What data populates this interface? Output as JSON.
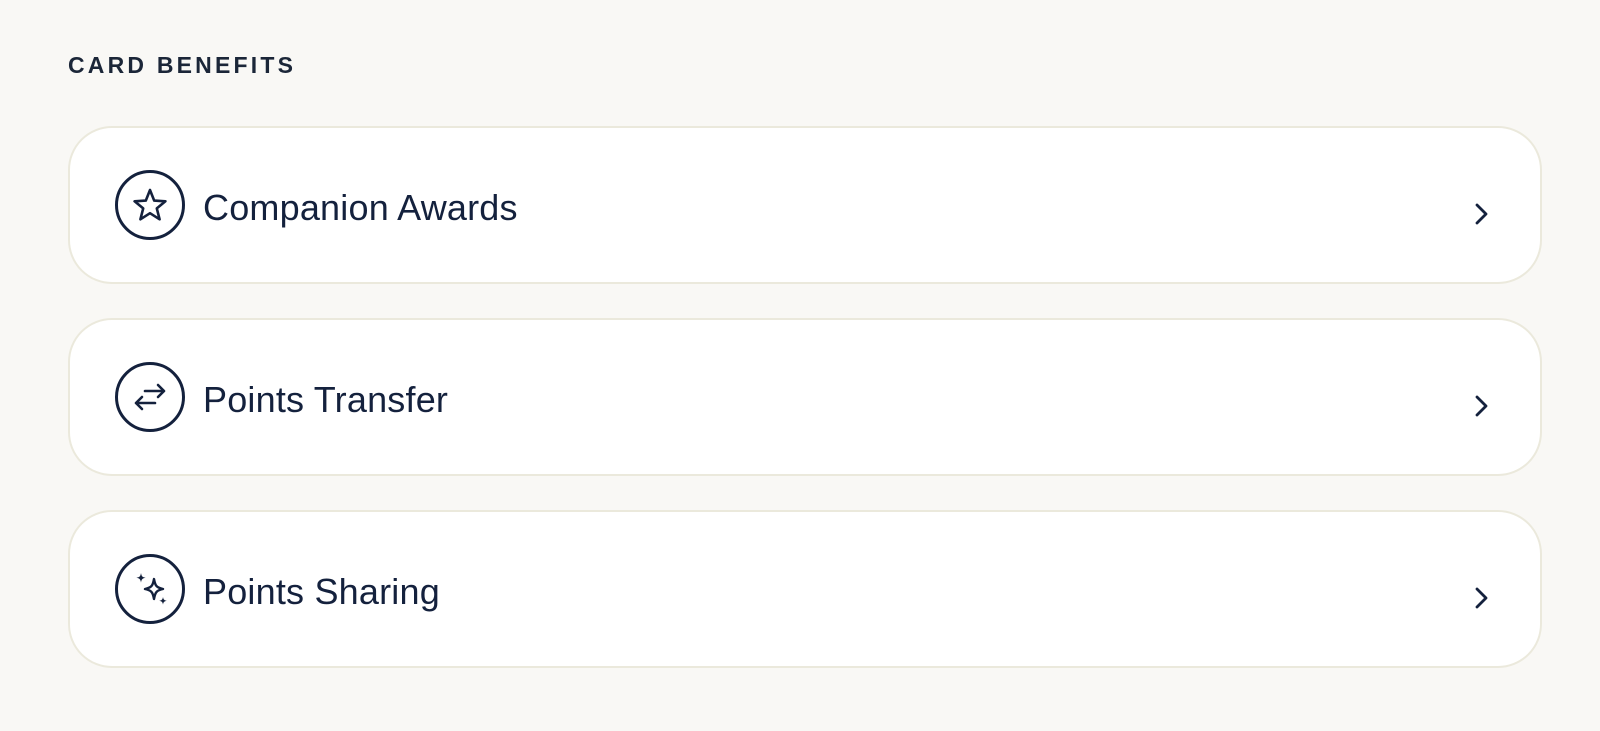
{
  "section": {
    "title": "CARD BENEFITS"
  },
  "benefits": [
    {
      "label": "Companion Awards",
      "icon": "star-icon"
    },
    {
      "label": "Points Transfer",
      "icon": "arrows-exchange-icon"
    },
    {
      "label": "Points Sharing",
      "icon": "sparkles-icon"
    }
  ],
  "colors": {
    "background": "#f9f8f5",
    "card": "#ffffff",
    "card_border": "#ebe9dc",
    "text": "#14213d"
  }
}
